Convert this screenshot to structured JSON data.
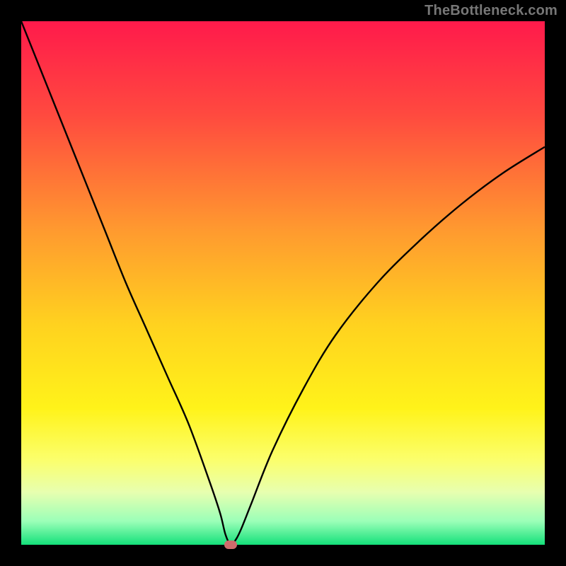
{
  "watermark": "TheBottleneck.com",
  "chart_data": {
    "type": "line",
    "title": "",
    "xlabel": "",
    "ylabel": "",
    "xlim": [
      0,
      100
    ],
    "ylim": [
      0,
      100
    ],
    "grid": false,
    "legend": false,
    "gradient_stops": [
      {
        "offset": 0.0,
        "color": "#ff1a4b"
      },
      {
        "offset": 0.18,
        "color": "#ff4a3f"
      },
      {
        "offset": 0.4,
        "color": "#ff9a2f"
      },
      {
        "offset": 0.58,
        "color": "#ffd21f"
      },
      {
        "offset": 0.74,
        "color": "#fff31a"
      },
      {
        "offset": 0.84,
        "color": "#fbff6e"
      },
      {
        "offset": 0.9,
        "color": "#e7ffb0"
      },
      {
        "offset": 0.955,
        "color": "#9bffb8"
      },
      {
        "offset": 1.0,
        "color": "#14e07a"
      }
    ],
    "series": [
      {
        "name": "bottleneck-curve",
        "x": [
          0,
          4,
          8,
          12,
          16,
          20,
          24,
          28,
          32,
          36,
          38,
          39,
          40,
          41,
          42,
          44,
          48,
          54,
          60,
          68,
          76,
          84,
          92,
          100
        ],
        "y": [
          100,
          90,
          80,
          70,
          60,
          50,
          41,
          32,
          23,
          12,
          6,
          2,
          0,
          1,
          3,
          8,
          18,
          30,
          40,
          50,
          58,
          65,
          71,
          76
        ]
      }
    ],
    "marker": {
      "x": 40,
      "y": 0,
      "color": "#cf6b6b"
    }
  }
}
